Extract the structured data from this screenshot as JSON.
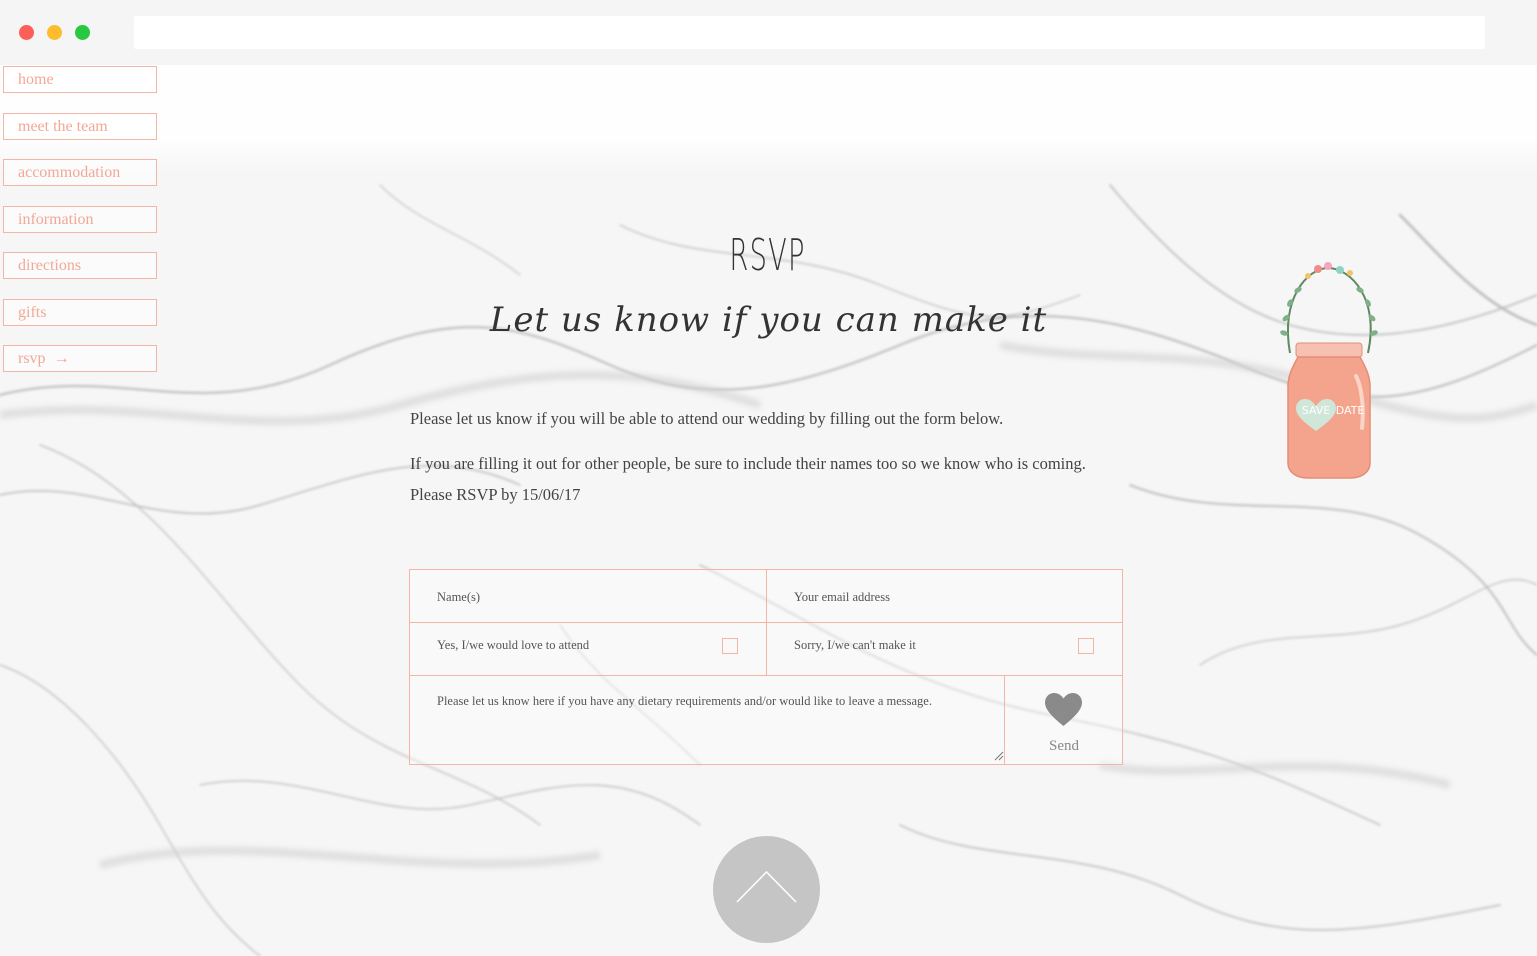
{
  "nav": {
    "items": [
      {
        "label": "home"
      },
      {
        "label": "meet the team"
      },
      {
        "label": "accommodation"
      },
      {
        "label": "information"
      },
      {
        "label": "directions"
      },
      {
        "label": "gifts"
      },
      {
        "label": "rsvp",
        "arrow": "→"
      }
    ]
  },
  "header": {
    "title": "RSVP",
    "subtitle": "Let us know if you can make it"
  },
  "intro": {
    "line1": "Please let us know if you will be able to attend our wedding by filling out the form below.",
    "line2": "If you are filling it out for other people, be sure to include their names too so we know who is coming.",
    "line3": "Please RSVP by 15/06/17"
  },
  "form": {
    "name_placeholder": "Name(s)",
    "email_placeholder": "Your email address",
    "attend_label": "Yes, I/we would love to attend",
    "decline_label": "Sorry, I/we can't make it",
    "message_placeholder": "Please let us know here if you have any dietary requirements and/or would like to leave a message.",
    "send_label": "Send",
    "send_icon": "heart-icon"
  },
  "decoration": {
    "jar_text_left": "SAVE",
    "jar_text_right": "DATE"
  },
  "colors": {
    "accent": "#f3b5a4",
    "nav_text": "#f2a896",
    "jar": "#f4a48d",
    "heart_jar": "#cfe6d8",
    "send_heart": "#8a8a8a"
  }
}
